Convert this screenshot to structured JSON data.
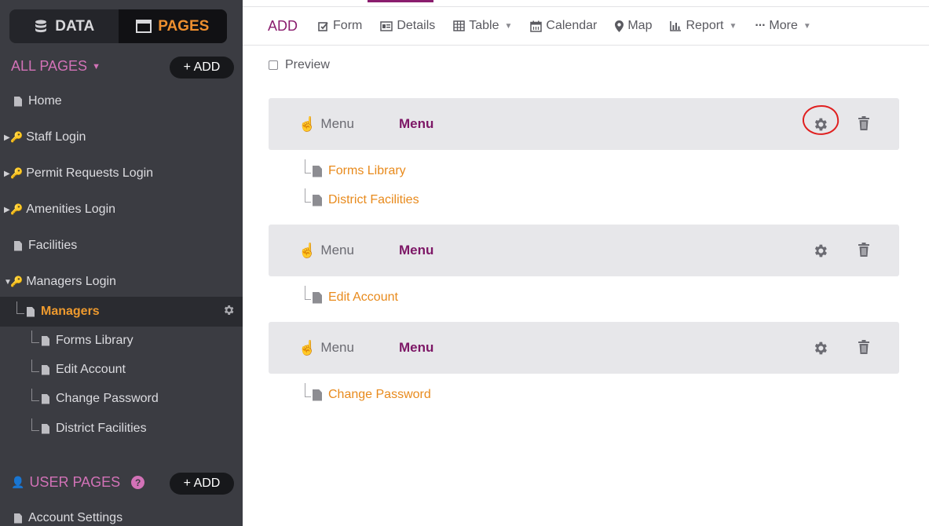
{
  "sidebar": {
    "data_tab": "DATA",
    "pages_tab": "PAGES",
    "all_pages_label": "ALL PAGES",
    "add_label": "+ ADD",
    "items": [
      {
        "label": "Home"
      },
      {
        "label": "Staff Login"
      },
      {
        "label": "Permit Requests Login"
      },
      {
        "label": "Amenities Login"
      },
      {
        "label": "Facilities"
      },
      {
        "label": "Managers Login"
      },
      {
        "label": "Managers"
      },
      {
        "label": "Forms Library"
      },
      {
        "label": "Edit Account"
      },
      {
        "label": "Change Password"
      },
      {
        "label": "District Facilities"
      }
    ],
    "user_pages_label": "USER PAGES",
    "user_add_label": "+ ADD",
    "account_settings": "Account Settings"
  },
  "toolbar": {
    "add": "ADD",
    "form": "Form",
    "details": "Details",
    "table": "Table",
    "calendar": "Calendar",
    "map": "Map",
    "report": "Report",
    "more": "More"
  },
  "preview_label": "Preview",
  "menus": [
    {
      "type": "Menu",
      "name": "Menu",
      "links": [
        "Forms Library",
        "District Facilities"
      ]
    },
    {
      "type": "Menu",
      "name": "Menu",
      "links": [
        "Edit Account"
      ]
    },
    {
      "type": "Menu",
      "name": "Menu",
      "links": [
        "Change Password"
      ]
    }
  ],
  "colors": {
    "sidebar_bg": "#3b3c42",
    "accent_orange": "#ee8f2f",
    "accent_purple": "#8a1d6e",
    "section_pink": "#d272b7",
    "link_orange": "#e88a1c",
    "annotation_red": "#e02020"
  }
}
